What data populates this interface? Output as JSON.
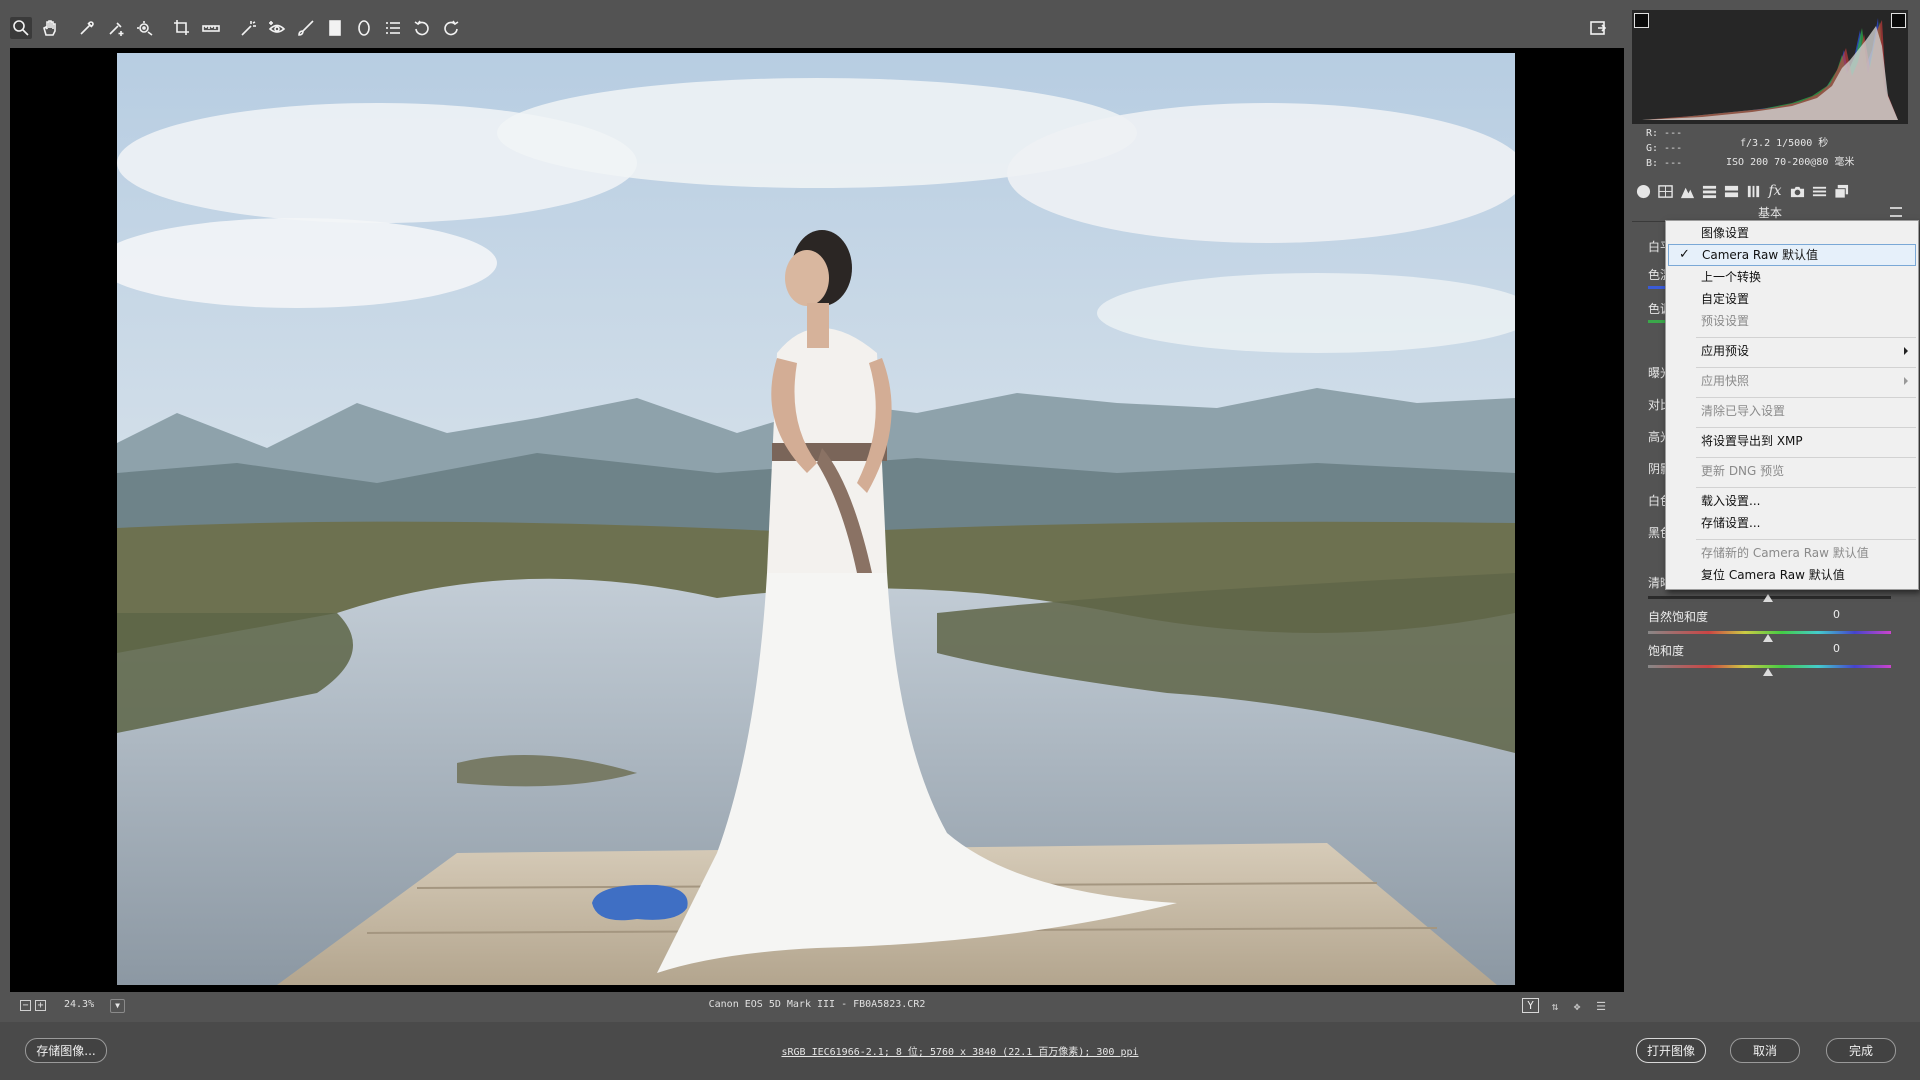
{
  "toolbar": {
    "tools": [
      "zoom-tool",
      "hand-tool",
      "white-balance-tool",
      "color-sampler-tool",
      "targeted-adjustment-tool",
      "crop-tool",
      "straighten-tool",
      "spot-removal-tool",
      "red-eye-removal-tool",
      "adjustment-brush-tool",
      "graduated-filter-tool",
      "radial-filter-tool",
      "preferences-tool",
      "rotate-left-tool",
      "rotate-right-tool"
    ],
    "active_tool": "zoom-tool"
  },
  "status": {
    "zoom": "24.3%",
    "file_info": "Canon EOS 5D Mark III -  FB0A5823.CR2",
    "view_toggle": "Y"
  },
  "bottom": {
    "save_label": "存储图像...",
    "workflow_info": "sRGB IEC61966-2.1; 8 位; 5760 x 3840 (22.1 百万像素); 300 ppi",
    "open_label": "打开图像",
    "cancel_label": "取消",
    "done_label": "完成"
  },
  "readout": {
    "r": "R:  ---",
    "g": "G:  ---",
    "b": "B:  ---",
    "aperture_shutter": "f/3.2  1/5000 秒",
    "iso_lens": "ISO 200  70-200@80 毫米"
  },
  "panel": {
    "title": "基本",
    "sliders": [
      {
        "label": "自然饱和度",
        "value": "0"
      },
      {
        "label": "饱和度",
        "value": "0"
      }
    ],
    "partial_labels": [
      "白平",
      "色温",
      "色调",
      "曝光",
      "对比",
      "高光",
      "阴影",
      "白色",
      "黑色",
      "清晰"
    ]
  },
  "menu": {
    "items": [
      {
        "label": "图像设置",
        "disabled": false
      },
      {
        "label": "Camera Raw 默认值",
        "disabled": false,
        "checked": true,
        "highlighted": true
      },
      {
        "label": "上一个转换",
        "disabled": false
      },
      {
        "label": "自定设置",
        "disabled": false
      },
      {
        "label": "预设设置",
        "disabled": true
      },
      {
        "label": "应用预设",
        "disabled": false,
        "submenu": true
      },
      {
        "label": "应用快照",
        "disabled": true,
        "submenu": true
      },
      {
        "label": "清除已导入设置",
        "disabled": true
      },
      {
        "label": "将设置导出到 XMP",
        "disabled": false
      },
      {
        "label": "更新 DNG 预览",
        "disabled": true
      },
      {
        "label": "载入设置...",
        "disabled": false
      },
      {
        "label": "存储设置...",
        "disabled": false
      },
      {
        "label": "存储新的 Camera Raw 默认值",
        "disabled": true
      },
      {
        "label": "复位 Camera Raw 默认值",
        "disabled": false
      }
    ],
    "check_glyph": "✓"
  },
  "colors": {
    "panel_bg": "#535353",
    "canvas_bg": "#000000",
    "menu_bg": "#f0f0f0",
    "menu_highlight": "#e6f0fa"
  }
}
